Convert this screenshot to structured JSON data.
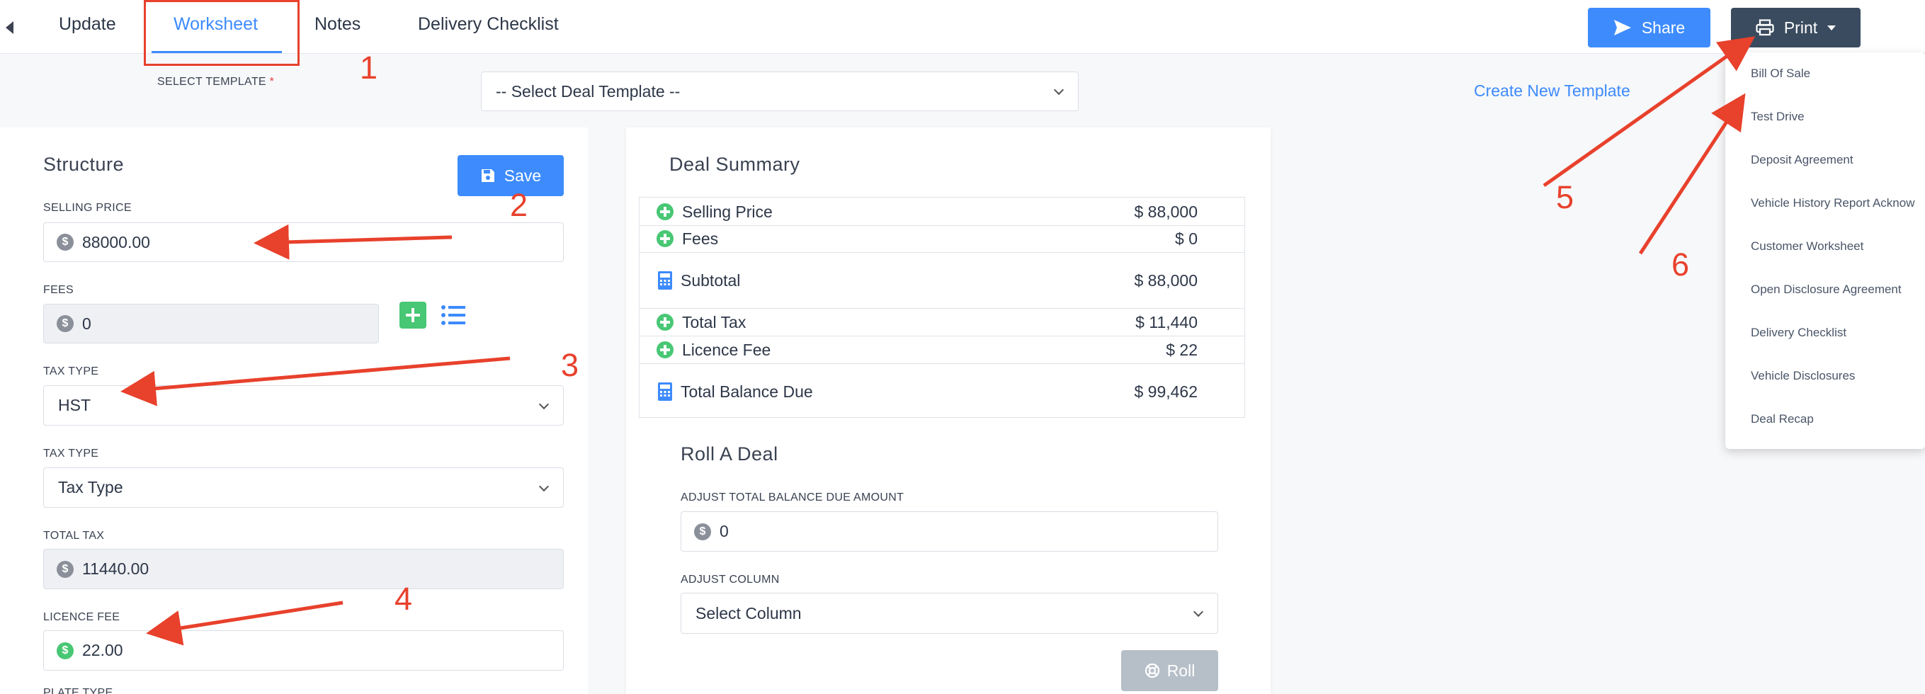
{
  "tabs": [
    {
      "label": "Update"
    },
    {
      "label": "Worksheet",
      "active": true
    },
    {
      "label": "Notes"
    },
    {
      "label": "Delivery Checklist"
    }
  ],
  "header_actions": {
    "share_label": "Share",
    "print_label": "Print"
  },
  "template": {
    "label": "SELECT TEMPLATE",
    "required_mark": "*",
    "select_value": "-- Select Deal Template --",
    "create_link": "Create New Template"
  },
  "structure": {
    "title": "Structure",
    "save_label": "Save",
    "fields": {
      "selling_price": {
        "label": "SELLING PRICE",
        "value": "88000.00"
      },
      "fees": {
        "label": "FEES",
        "value": "0"
      },
      "tax_type_1": {
        "label": "TAX TYPE",
        "value": "HST"
      },
      "tax_type_2": {
        "label": "TAX TYPE",
        "value": "Tax Type"
      },
      "total_tax": {
        "label": "TOTAL TAX",
        "value": "11440.00"
      },
      "licence_fee": {
        "label": "LICENCE FEE",
        "value": "22.00"
      },
      "plate_type": {
        "label": "PLATE TYPE"
      }
    }
  },
  "deal_summary": {
    "title": "Deal Summary",
    "rows": [
      {
        "label": "Selling Price",
        "amount": "$ 88,000",
        "icon": "plus-circle-icon"
      },
      {
        "label": "Fees",
        "amount": "$ 0",
        "icon": "plus-circle-icon"
      },
      {
        "label": "Subtotal",
        "amount": "$ 88,000",
        "icon": "calculator-icon"
      },
      {
        "label": "Total Tax",
        "amount": "$ 11,440",
        "icon": "plus-circle-icon"
      },
      {
        "label": "Licence Fee",
        "amount": "$ 22",
        "icon": "plus-circle-icon"
      },
      {
        "label": "Total Balance Due",
        "amount": "$ 99,462",
        "icon": "calculator-icon"
      }
    ]
  },
  "roll_a_deal": {
    "title": "Roll A Deal",
    "adjust_balance_label": "ADJUST TOTAL BALANCE DUE AMOUNT",
    "adjust_balance_value": "0",
    "adjust_column_label": "ADJUST COLUMN",
    "adjust_column_value": "Select Column",
    "roll_label": "Roll"
  },
  "print_menu": {
    "items": [
      "Bill Of Sale",
      "Test Drive",
      "Deposit Agreement",
      "Vehicle History Report Acknow",
      "Customer Worksheet",
      "Open Disclosure Agreement",
      "Delivery Checklist",
      "Vehicle Disclosures",
      "Deal Recap"
    ]
  },
  "annotations": {
    "numbers": [
      "1",
      "2",
      "3",
      "4",
      "5",
      "6"
    ],
    "color": "#e8412c"
  },
  "colors": {
    "primary": "#3d8bfd",
    "print_button": "#3a4b5f",
    "success": "#48c774",
    "roll_disabled": "#b6bec8"
  }
}
